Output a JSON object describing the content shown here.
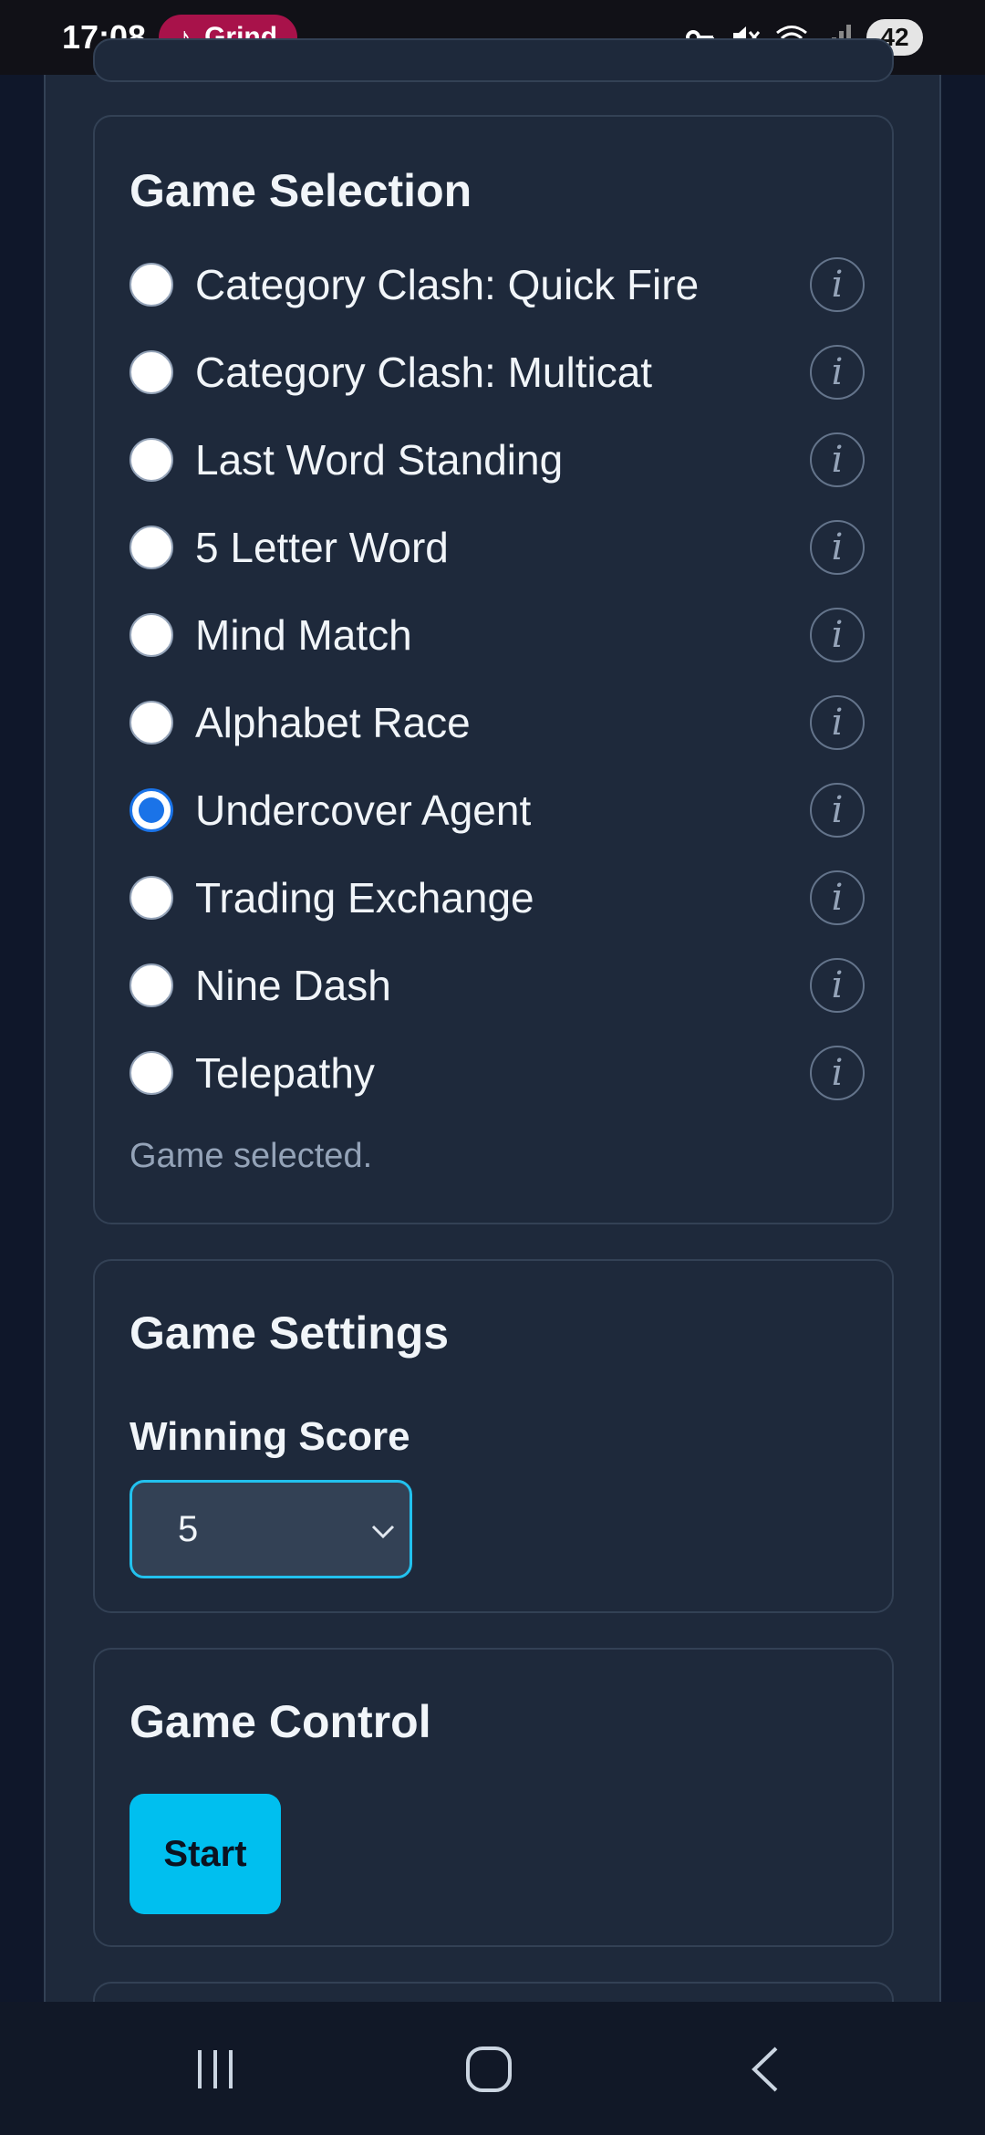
{
  "status_bar": {
    "time": "17:08",
    "media_label": "Grind",
    "battery": "42",
    "icons": [
      "vpn-key-icon",
      "mute-icon",
      "wifi-icon",
      "signal-icon"
    ]
  },
  "game_selection": {
    "title": "Game Selection",
    "games": [
      {
        "label": "Category Clash: Quick Fire",
        "selected": false
      },
      {
        "label": "Category Clash: Multicat",
        "selected": false
      },
      {
        "label": "Last Word Standing",
        "selected": false
      },
      {
        "label": "5 Letter Word",
        "selected": false
      },
      {
        "label": "Mind Match",
        "selected": false
      },
      {
        "label": "Alphabet Race",
        "selected": false
      },
      {
        "label": "Undercover Agent",
        "selected": true
      },
      {
        "label": "Trading Exchange",
        "selected": false
      },
      {
        "label": "Nine Dash",
        "selected": false
      },
      {
        "label": "Telepathy",
        "selected": false
      }
    ],
    "info_glyph": "i",
    "status": "Game selected."
  },
  "game_settings": {
    "title": "Game Settings",
    "winning_score_label": "Winning Score",
    "winning_score_value": "5"
  },
  "game_control": {
    "title": "Game Control",
    "start_label": "Start"
  },
  "colors": {
    "background": "#0f172a",
    "card": "#1e293b",
    "accent": "#00bfef",
    "radio_selected": "#1a73e8",
    "media_pill": "#a8124a"
  }
}
